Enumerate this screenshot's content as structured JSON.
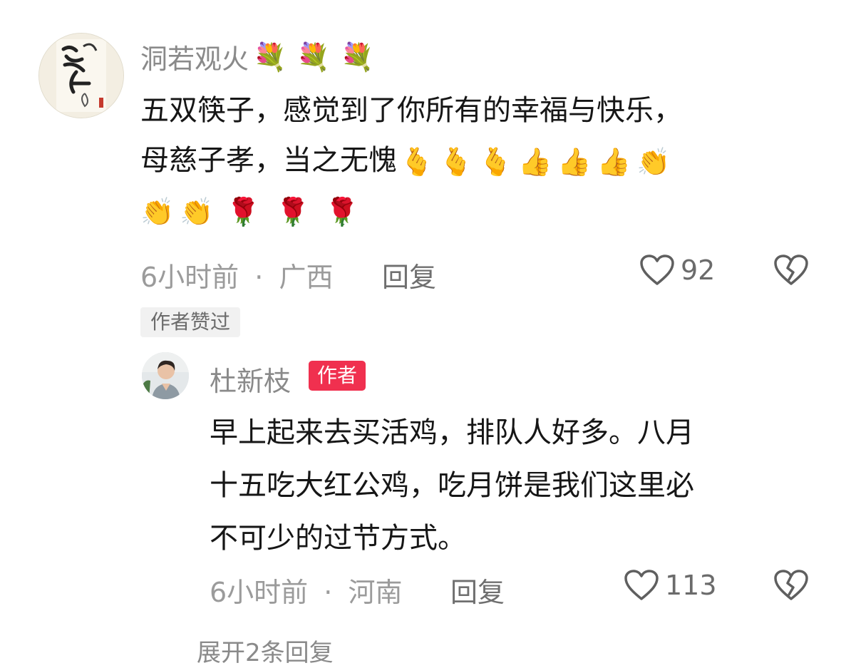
{
  "comment": {
    "username": "洞若观火",
    "username_emojis": [
      "💐",
      "💐",
      "💐"
    ],
    "text_line1": "五双筷子，感觉到了你所有的幸福与快乐，",
    "text_line2": "母慈子孝，当之无愧",
    "line2_emojis": [
      "🫰",
      "🫰",
      "🫰",
      "👍",
      "👍",
      "👍",
      "👏"
    ],
    "line3_emojis": [
      "👏",
      "👏",
      "🌹",
      "🌹",
      "🌹"
    ],
    "time": "6小时前",
    "separator": "·",
    "location": "广西",
    "reply_label": "回复",
    "like_count": "92",
    "liked_tag": "作者赞过"
  },
  "reply": {
    "username": "杜新枝",
    "author_badge": "作者",
    "text_line1": "早上起来去买活鸡，排队人好多。八月",
    "text_line2": "十五吃大红公鸡，吃月饼是我们这里必",
    "text_line3": "不可少的过节方式。",
    "time": "6小时前",
    "separator": "·",
    "location": "河南",
    "reply_label": "回复",
    "like_count": "113"
  },
  "more_replies": "展开2条回复",
  "icons": {
    "like": "heart-outline-icon",
    "dislike": "broken-heart-icon"
  },
  "colors": {
    "badge": "#f0304f",
    "meta": "#9b9b9b"
  }
}
